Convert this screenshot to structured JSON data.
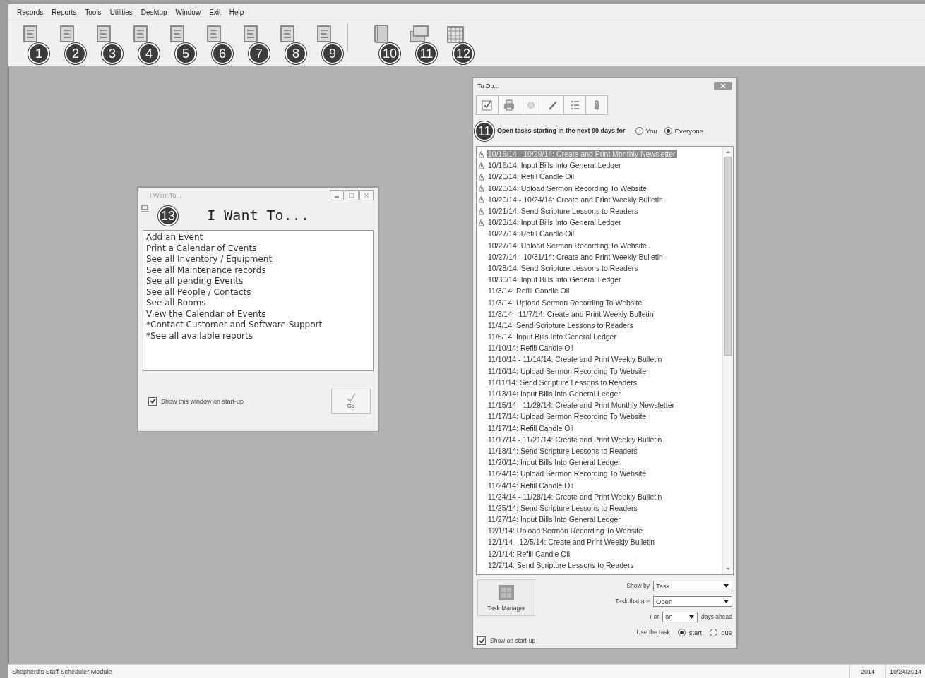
{
  "menu": [
    "Records",
    "Reports",
    "Tools",
    "Utilities",
    "Desktop",
    "Window",
    "Exit",
    "Help"
  ],
  "toolbar": [
    {
      "callout": "1"
    },
    {
      "callout": "2"
    },
    {
      "callout": "3"
    },
    {
      "callout": "4"
    },
    {
      "callout": "5"
    },
    {
      "callout": "6"
    },
    {
      "callout": "7"
    },
    {
      "callout": "8"
    },
    {
      "callout": "9"
    },
    {
      "callout": "10"
    },
    {
      "callout": "11"
    },
    {
      "callout": "12"
    }
  ],
  "i_want_to": {
    "title": "I Want To...",
    "callout": "13",
    "heading": "I Want To...",
    "items": [
      "Add an Event",
      "Print a Calendar of Events",
      "See all Inventory / Equipment",
      "See all Maintenance records",
      "See all pending Events",
      "See all People / Contacts",
      "See all Rooms",
      "View the Calendar of Events",
      "*Contact Customer and Software Support",
      "*See all available reports"
    ],
    "show_on_startup": {
      "label": "Show this window on start-up",
      "checked": true
    },
    "go_button": "Go"
  },
  "to_do": {
    "title": "To Do...",
    "callout": "11",
    "filter_label": "Open tasks starting in the next 90 days for",
    "scope": [
      {
        "label": "You",
        "selected": false
      },
      {
        "label": "Everyone",
        "selected": true
      }
    ],
    "tasks": [
      {
        "text": "10/15/14 - 10/29/14: Create and Print Monthly Newsletter",
        "flagged": true,
        "selected": true
      },
      {
        "text": "10/16/14: Input Bills Into General Ledger",
        "flagged": true,
        "selected": false
      },
      {
        "text": "10/20/14: Refill Candle Oil",
        "flagged": true,
        "selected": false
      },
      {
        "text": "10/20/14: Upload Sermon Recording To Website",
        "flagged": true,
        "selected": false
      },
      {
        "text": "10/20/14 - 10/24/14: Create and Print Weekly Bulletin",
        "flagged": true,
        "selected": false
      },
      {
        "text": "10/21/14: Send Scripture Lessons to Readers",
        "flagged": true,
        "selected": false
      },
      {
        "text": "10/23/14: Input Bills Into General Ledger",
        "flagged": true,
        "selected": false
      },
      {
        "text": "10/27/14: Refill Candle Oil",
        "flagged": false,
        "selected": false
      },
      {
        "text": "10/27/14: Upload Sermon Recording To Website",
        "flagged": false,
        "selected": false
      },
      {
        "text": "10/27/14 - 10/31/14: Create and Print Weekly Bulletin",
        "flagged": false,
        "selected": false
      },
      {
        "text": "10/28/14: Send Scripture Lessons to Readers",
        "flagged": false,
        "selected": false
      },
      {
        "text": "10/30/14: Input Bills Into General Ledger",
        "flagged": false,
        "selected": false
      },
      {
        "text": "11/3/14: Refill Candle Oil",
        "flagged": false,
        "selected": false
      },
      {
        "text": "11/3/14: Upload Sermon Recording To Website",
        "flagged": false,
        "selected": false
      },
      {
        "text": "11/3/14 - 11/7/14: Create and Print Weekly Bulletin",
        "flagged": false,
        "selected": false
      },
      {
        "text": "11/4/14: Send Scripture Lessons to Readers",
        "flagged": false,
        "selected": false
      },
      {
        "text": "11/6/14: Input Bills Into General Ledger",
        "flagged": false,
        "selected": false
      },
      {
        "text": "11/10/14: Refill Candle Oil",
        "flagged": false,
        "selected": false
      },
      {
        "text": "11/10/14 - 11/14/14: Create and Print Weekly Bulletin",
        "flagged": false,
        "selected": false
      },
      {
        "text": "11/10/14: Upload Sermon Recording To Website",
        "flagged": false,
        "selected": false
      },
      {
        "text": "11/11/14: Send Scripture Lessons to Readers",
        "flagged": false,
        "selected": false
      },
      {
        "text": "11/13/14: Input Bills Into General Ledger",
        "flagged": false,
        "selected": false
      },
      {
        "text": "11/15/14 - 11/29/14: Create and Print Monthly Newsletter",
        "flagged": false,
        "selected": false
      },
      {
        "text": "11/17/14: Upload Sermon Recording To Website",
        "flagged": false,
        "selected": false
      },
      {
        "text": "11/17/14: Refill Candle Oil",
        "flagged": false,
        "selected": false
      },
      {
        "text": "11/17/14 - 11/21/14: Create and Print Weekly Bulletin",
        "flagged": false,
        "selected": false
      },
      {
        "text": "11/18/14: Send Scripture Lessons to Readers",
        "flagged": false,
        "selected": false
      },
      {
        "text": "11/20/14: Input Bills Into General Ledger",
        "flagged": false,
        "selected": false
      },
      {
        "text": "11/24/14: Upload Sermon Recording To Website",
        "flagged": false,
        "selected": false
      },
      {
        "text": "11/24/14: Refill Candle Oil",
        "flagged": false,
        "selected": false
      },
      {
        "text": "11/24/14 - 11/28/14: Create and Print Weekly Bulletin",
        "flagged": false,
        "selected": false
      },
      {
        "text": "11/25/14: Send Scripture Lessons to Readers",
        "flagged": false,
        "selected": false
      },
      {
        "text": "11/27/14: Input Bills Into General Ledger",
        "flagged": false,
        "selected": false
      },
      {
        "text": "12/1/14: Upload Sermon Recording To Website",
        "flagged": false,
        "selected": false
      },
      {
        "text": "12/1/14 - 12/5/14: Create and Print Weekly Bulletin",
        "flagged": false,
        "selected": false
      },
      {
        "text": "12/1/14: Refill Candle Oil",
        "flagged": false,
        "selected": false
      },
      {
        "text": "12/2/14: Send Scripture Lessons to Readers",
        "flagged": false,
        "selected": false
      }
    ],
    "task_manager_button": "Task Manager",
    "show_by": {
      "label": "Show by",
      "value": "Task"
    },
    "tasks_that_are": {
      "label": "Task that are",
      "value": "Open"
    },
    "for": {
      "label": "For",
      "value": "90",
      "suffix": "days ahead"
    },
    "use_the_task": {
      "label": "Use the task",
      "options": [
        {
          "label": "start",
          "selected": true
        },
        {
          "label": "due",
          "selected": false
        }
      ]
    },
    "show_on_startup": {
      "label": "Show on start-up",
      "checked": true
    }
  },
  "status_bar": {
    "module": "Shepherd's Staff Scheduler Module",
    "year": "2014",
    "date": "10/24/2014"
  }
}
